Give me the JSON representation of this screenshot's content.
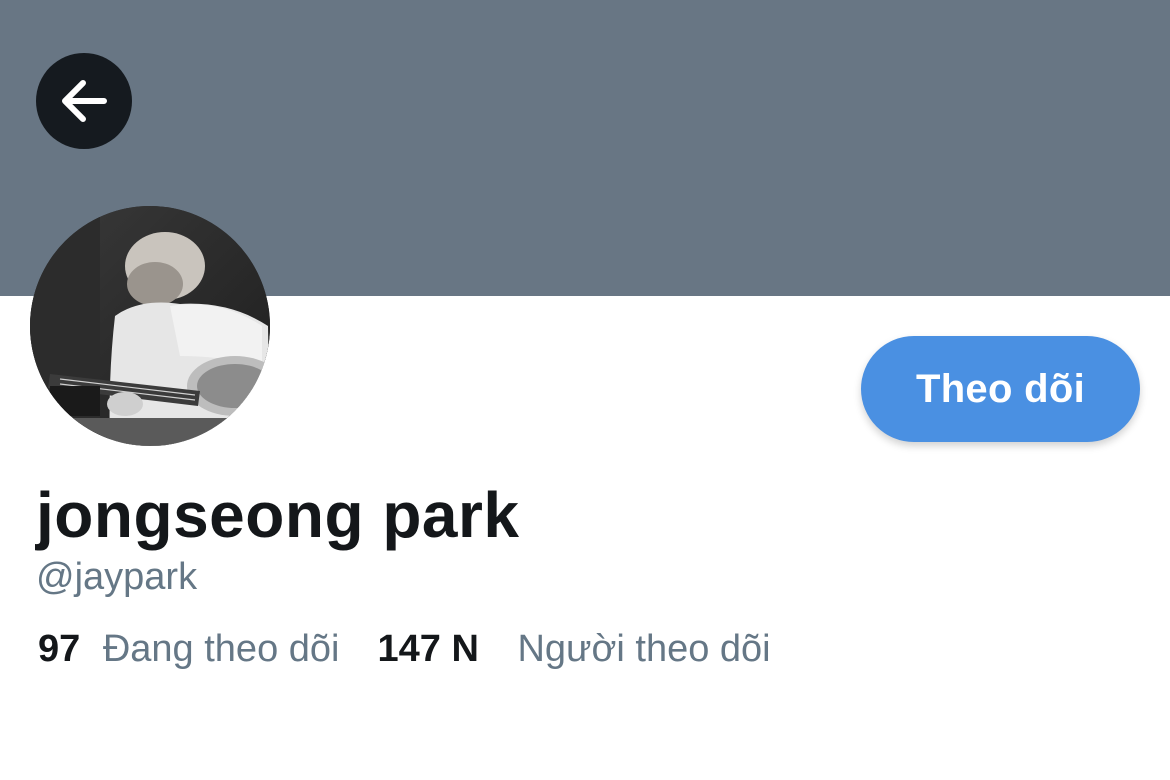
{
  "colors": {
    "banner": "#687684",
    "back_button_bg": "#151a1f",
    "accent": "#4a90e2",
    "text_primary": "#14171a",
    "text_secondary": "#657786"
  },
  "header": {
    "back_icon": "arrow-left-icon"
  },
  "profile": {
    "display_name": "jongseong park",
    "handle": "@jaypark",
    "follow_button_label": "Theo dõi",
    "following_count": "97",
    "following_label": "Đang theo dõi",
    "followers_count": "147 N",
    "followers_label": "Người theo dõi"
  }
}
